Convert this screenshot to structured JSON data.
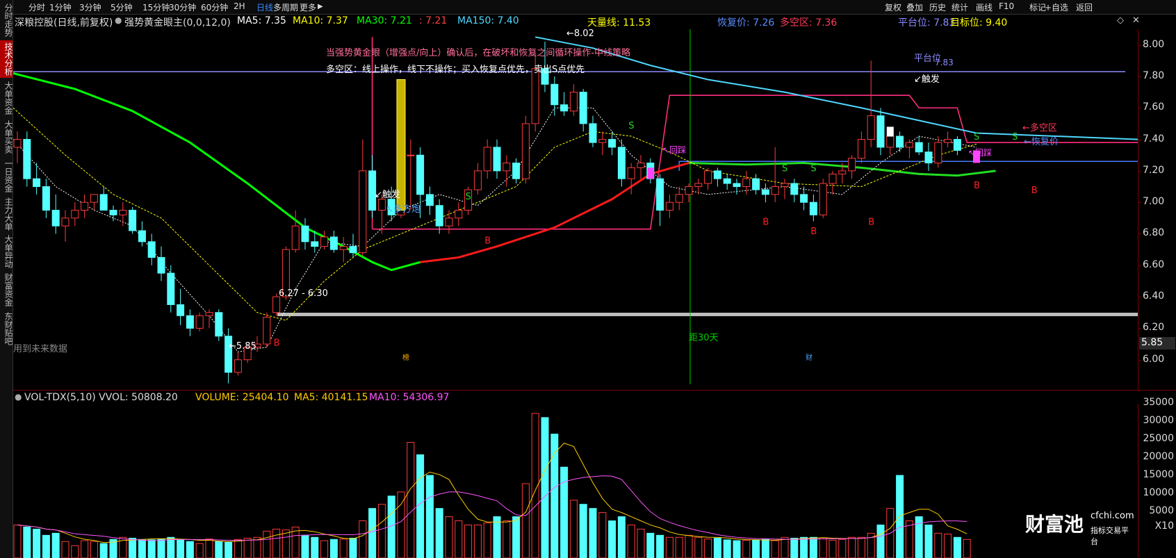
{
  "sidebar": {
    "tabs": [
      {
        "label": "分时走势",
        "active": false
      },
      {
        "label": "技术分析",
        "active": true
      },
      {
        "label": "大单资金",
        "active": false
      },
      {
        "label": "大单买卖",
        "active": false
      },
      {
        "label": "一日资金",
        "active": false
      },
      {
        "label": "主力大单",
        "active": false
      },
      {
        "label": "大单异动",
        "active": false
      },
      {
        "label": "财富资金",
        "active": false
      },
      {
        "label": "东财贴吧",
        "active": false
      }
    ]
  },
  "toolbar": {
    "periods": [
      "分时",
      "1分钟",
      "3分钟",
      "5分钟",
      "15分钟",
      "30分钟",
      "60分钟",
      "2H",
      "日线",
      "多周期",
      "更多"
    ],
    "active_period": "日线",
    "right_items": [
      "复权",
      "叠加",
      "历史",
      "统计",
      "画线",
      "F10",
      "标记",
      "+自选",
      "返回"
    ]
  },
  "info": {
    "stock": "深粮控股(日线,前复权)",
    "indicator": "强势黄金眼主(0,0,12,0)",
    "ma5": "MA5: 7.35",
    "ma10": "MA10: 7.37",
    "ma30": "MA30: 7.21",
    "ma30b": ": 7.21",
    "ma150": "MA150: 7.40",
    "tianliang": "天量线: 11.53",
    "huifu": "恢复价: 7.26",
    "duokong": "多空区: 7.36",
    "pingtai": "平台位: 7.83",
    "mubiao": "目标位: 9.40"
  },
  "chart_text": {
    "strategy1": "当强势黄金眼（增强点/向上）确认后，在破坏和恢复之间循环操作-中线策略",
    "strategy2": "多空区：线上操作，线下不操作；买入恢复点优先，卖出S点优先",
    "high_label": "8.02",
    "low_label": "5.85",
    "range_label": "6.27 - 6.30",
    "trigger1": "触发",
    "trigger2": "触发",
    "duofang": "多方炮",
    "pingtai_mark": "平台位",
    "pingtai_val": "7.83",
    "duokong_mark": "多空区",
    "huifu_mark": "恢复价",
    "huicai1": "回踩",
    "huicai2": "回踩",
    "days30": "距30天",
    "future": "用到未来数据",
    "bang": "榜",
    "cai": "财"
  },
  "price_axis": {
    "ticks": [
      "8.00",
      "7.80",
      "7.60",
      "7.40",
      "7.20",
      "7.00",
      "6.80",
      "6.60",
      "6.40",
      "6.20",
      "6.00"
    ],
    "low_box": "5.85"
  },
  "volume": {
    "title": "VOL-TDX(5,10) VVOL: 50808.20",
    "volume": "VOLUME: 25404.10",
    "ma5": "MA5: 40141.15",
    "ma10": "MA10: 54306.97",
    "ticks": [
      "35000",
      "30000",
      "25000",
      "20000",
      "15000",
      "10000",
      "5000",
      "X10"
    ]
  },
  "brand": {
    "name": "财富池",
    "site": "cfchi.com",
    "slogan": "指标交易平台"
  },
  "colors": {
    "up": "#ff3b3b",
    "down": "#54ffff",
    "ma5": "#ffffff",
    "ma10": "#ffff00",
    "ma30": "#00ff00",
    "ma150": "#4fd8ff",
    "accent": "#3d8bff",
    "pink": "#ff2e7e"
  },
  "chart_data": {
    "type": "candlestick",
    "ylim": [
      5.8,
      8.1
    ],
    "candles": [
      [
        7.35,
        7.45,
        7.25,
        7.4
      ],
      [
        7.4,
        7.45,
        7.1,
        7.15
      ],
      [
        7.15,
        7.25,
        7.05,
        7.1
      ],
      [
        7.1,
        7.15,
        6.9,
        6.95
      ],
      [
        6.95,
        7.05,
        6.8,
        6.85
      ],
      [
        6.85,
        6.95,
        6.75,
        6.9
      ],
      [
        6.9,
        7.0,
        6.85,
        6.95
      ],
      [
        6.95,
        7.05,
        6.9,
        7.0
      ],
      [
        7.0,
        7.05,
        6.95,
        7.05
      ],
      [
        7.05,
        7.1,
        6.95,
        6.95
      ],
      [
        6.95,
        6.98,
        6.88,
        6.92
      ],
      [
        6.92,
        7.0,
        6.85,
        6.95
      ],
      [
        6.95,
        6.97,
        6.8,
        6.82
      ],
      [
        6.82,
        6.88,
        6.72,
        6.75
      ],
      [
        6.75,
        6.8,
        6.6,
        6.65
      ],
      [
        6.65,
        6.72,
        6.5,
        6.55
      ],
      [
        6.55,
        6.6,
        6.3,
        6.35
      ],
      [
        6.35,
        6.45,
        6.22,
        6.28
      ],
      [
        6.28,
        6.32,
        6.15,
        6.2
      ],
      [
        6.2,
        6.3,
        6.18,
        6.28
      ],
      [
        6.28,
        6.32,
        6.2,
        6.3
      ],
      [
        6.3,
        6.32,
        6.12,
        6.15
      ],
      [
        6.15,
        6.2,
        5.85,
        5.92
      ],
      [
        5.92,
        6.05,
        5.9,
        6.0
      ],
      [
        6.0,
        6.1,
        5.98,
        6.08
      ],
      [
        6.08,
        6.15,
        6.05,
        6.1
      ],
      [
        6.1,
        6.3,
        6.08,
        6.27
      ],
      [
        6.3,
        6.42,
        6.28,
        6.4
      ],
      [
        6.4,
        6.72,
        6.38,
        6.7
      ],
      [
        6.7,
        6.95,
        6.68,
        6.85
      ],
      [
        6.85,
        6.9,
        6.7,
        6.75
      ],
      [
        6.75,
        6.82,
        6.68,
        6.72
      ],
      [
        6.72,
        6.82,
        6.7,
        6.78
      ],
      [
        6.78,
        6.82,
        6.68,
        6.7
      ],
      [
        6.7,
        6.78,
        6.62,
        6.72
      ],
      [
        6.72,
        6.8,
        6.65,
        6.68
      ],
      [
        6.68,
        7.4,
        6.66,
        7.2
      ],
      [
        7.2,
        7.3,
        6.9,
        6.95
      ],
      [
        6.95,
        7.05,
        6.8,
        7.02
      ],
      [
        7.02,
        7.1,
        6.88,
        6.92
      ],
      [
        6.92,
        7.78,
        6.9,
        7.75
      ],
      [
        7.3,
        7.4,
        6.95,
        7.3
      ],
      [
        7.3,
        7.35,
        6.9,
        7.05
      ],
      [
        7.05,
        7.1,
        6.92,
        6.98
      ],
      [
        6.98,
        7.02,
        6.8,
        6.85
      ],
      [
        6.85,
        6.95,
        6.8,
        6.9
      ],
      [
        6.9,
        7.0,
        6.85,
        6.95
      ],
      [
        6.95,
        7.1,
        6.92,
        7.08
      ],
      [
        7.08,
        7.25,
        7.05,
        7.2
      ],
      [
        7.2,
        7.4,
        7.15,
        7.35
      ],
      [
        7.35,
        7.4,
        7.15,
        7.2
      ],
      [
        7.2,
        7.3,
        7.1,
        7.25
      ],
      [
        7.25,
        7.28,
        7.12,
        7.15
      ],
      [
        7.15,
        7.55,
        7.12,
        7.5
      ],
      [
        7.5,
        7.95,
        7.45,
        7.85
      ],
      [
        7.85,
        8.02,
        7.7,
        7.75
      ],
      [
        7.75,
        7.8,
        7.55,
        7.62
      ],
      [
        7.62,
        7.7,
        7.55,
        7.58
      ],
      [
        7.58,
        7.75,
        7.55,
        7.7
      ],
      [
        7.7,
        7.72,
        7.45,
        7.5
      ],
      [
        7.5,
        7.55,
        7.35,
        7.38
      ],
      [
        7.38,
        7.45,
        7.3,
        7.4
      ],
      [
        7.4,
        7.45,
        7.3,
        7.35
      ],
      [
        7.35,
        7.4,
        7.1,
        7.15
      ],
      [
        7.15,
        7.25,
        7.05,
        7.22
      ],
      [
        7.22,
        7.3,
        7.15,
        7.25
      ],
      [
        7.25,
        7.28,
        7.12,
        7.15
      ],
      [
        7.15,
        7.18,
        6.85,
        6.95
      ],
      [
        6.95,
        7.05,
        6.9,
        7.0
      ],
      [
        7.0,
        7.1,
        6.95,
        7.05
      ],
      [
        7.05,
        7.12,
        7.0,
        7.1
      ],
      [
        7.1,
        7.15,
        7.05,
        7.12
      ],
      [
        7.12,
        7.22,
        7.08,
        7.2
      ],
      [
        7.2,
        7.22,
        7.1,
        7.15
      ],
      [
        7.15,
        7.18,
        7.08,
        7.12
      ],
      [
        7.12,
        7.15,
        7.05,
        7.1
      ],
      [
        7.1,
        7.2,
        7.05,
        7.15
      ],
      [
        7.15,
        7.18,
        7.05,
        7.08
      ],
      [
        7.08,
        7.12,
        7.0,
        7.05
      ],
      [
        7.05,
        7.35,
        7.0,
        7.1
      ],
      [
        7.1,
        7.15,
        7.02,
        7.12
      ],
      [
        7.12,
        7.15,
        7.0,
        7.05
      ],
      [
        7.05,
        7.1,
        6.95,
        7.0
      ],
      [
        7.0,
        7.05,
        6.88,
        6.92
      ],
      [
        6.92,
        7.15,
        6.9,
        7.12
      ],
      [
        7.12,
        7.2,
        7.05,
        7.18
      ],
      [
        7.18,
        7.25,
        7.12,
        7.2
      ],
      [
        7.2,
        7.3,
        7.15,
        7.28
      ],
      [
        7.28,
        7.45,
        7.25,
        7.4
      ],
      [
        7.4,
        7.9,
        7.35,
        7.55
      ],
      [
        7.55,
        7.6,
        7.3,
        7.35
      ],
      [
        7.35,
        7.45,
        7.3,
        7.42
      ],
      [
        7.42,
        7.45,
        7.32,
        7.35
      ],
      [
        7.35,
        7.4,
        7.28,
        7.38
      ],
      [
        7.38,
        7.42,
        7.3,
        7.32
      ],
      [
        7.32,
        7.38,
        7.2,
        7.25
      ],
      [
        7.25,
        7.42,
        7.22,
        7.38
      ],
      [
        7.38,
        7.45,
        7.35,
        7.4
      ],
      [
        7.4,
        7.42,
        7.3,
        7.33
      ]
    ],
    "volumes": [
      8,
      7.5,
      7,
      5.5,
      6,
      4,
      3,
      4.2,
      4,
      3.5,
      4.5,
      5,
      4.8,
      4.5,
      4.4,
      4.6,
      5,
      4.4,
      4,
      3.5,
      4.6,
      4,
      3.8,
      4.5,
      4.8,
      5,
      6.5,
      7,
      6.8,
      7.5,
      5.5,
      5,
      4.2,
      4.5,
      4.6,
      4.8,
      9,
      12,
      13,
      15,
      16,
      28,
      25,
      20,
      12,
      10,
      9,
      8,
      8,
      8.5,
      10,
      9,
      10,
      18,
      35,
      34,
      30,
      22,
      14,
      13,
      12,
      11,
      9,
      10,
      8,
      7,
      6,
      5.5,
      5,
      5,
      5.5,
      5,
      4.6,
      4.8,
      4.4,
      4.2,
      4.3,
      4.4,
      4.5,
      4.2,
      5,
      4.8,
      5,
      5,
      4.9,
      4.3,
      4.5,
      5,
      5,
      6,
      8,
      12,
      20,
      9,
      10,
      8,
      6,
      5.8,
      5,
      4.5
    ]
  }
}
